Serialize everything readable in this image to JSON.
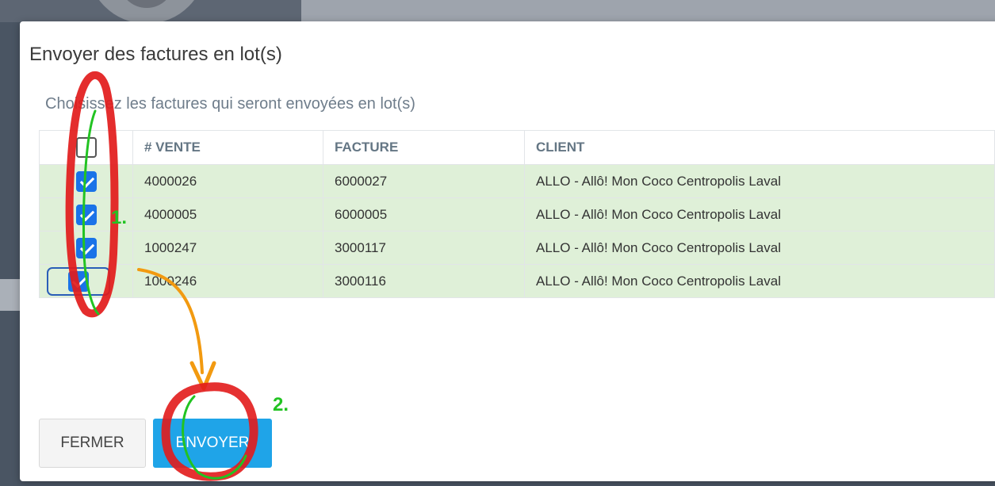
{
  "modal": {
    "title": "Envoyer des factures en lot(s)",
    "subtitle": "Choisissez les factures qui seront envoyées en lot(s)"
  },
  "table": {
    "headers": [
      "",
      "# VENTE",
      "FACTURE",
      "CLIENT"
    ],
    "select_all_checked": false,
    "rows": [
      {
        "checked": true,
        "vente": "4000026",
        "facture": "6000027",
        "client": "ALLO - Allô! Mon Coco Centropolis Laval"
      },
      {
        "checked": true,
        "vente": "4000005",
        "facture": "6000005",
        "client": "ALLO - Allô! Mon Coco Centropolis Laval"
      },
      {
        "checked": true,
        "vente": "1000247",
        "facture": "3000117",
        "client": "ALLO - Allô! Mon Coco Centropolis Laval"
      },
      {
        "checked": true,
        "vente": "1000246",
        "facture": "3000116",
        "client": "ALLO - Allô! Mon Coco Centropolis Laval"
      }
    ]
  },
  "buttons": {
    "close_label": "FERMER",
    "send_label": "ENVOYER"
  },
  "annotations": {
    "step1": "1.",
    "step2": "2."
  },
  "colors": {
    "selected_row": "#dff0d8",
    "send_button": "#1fa4e8",
    "checkbox": "#1a73e8",
    "annotation_red": "#e21b1b",
    "annotation_green": "#22c322",
    "annotation_orange": "#f29a10"
  }
}
